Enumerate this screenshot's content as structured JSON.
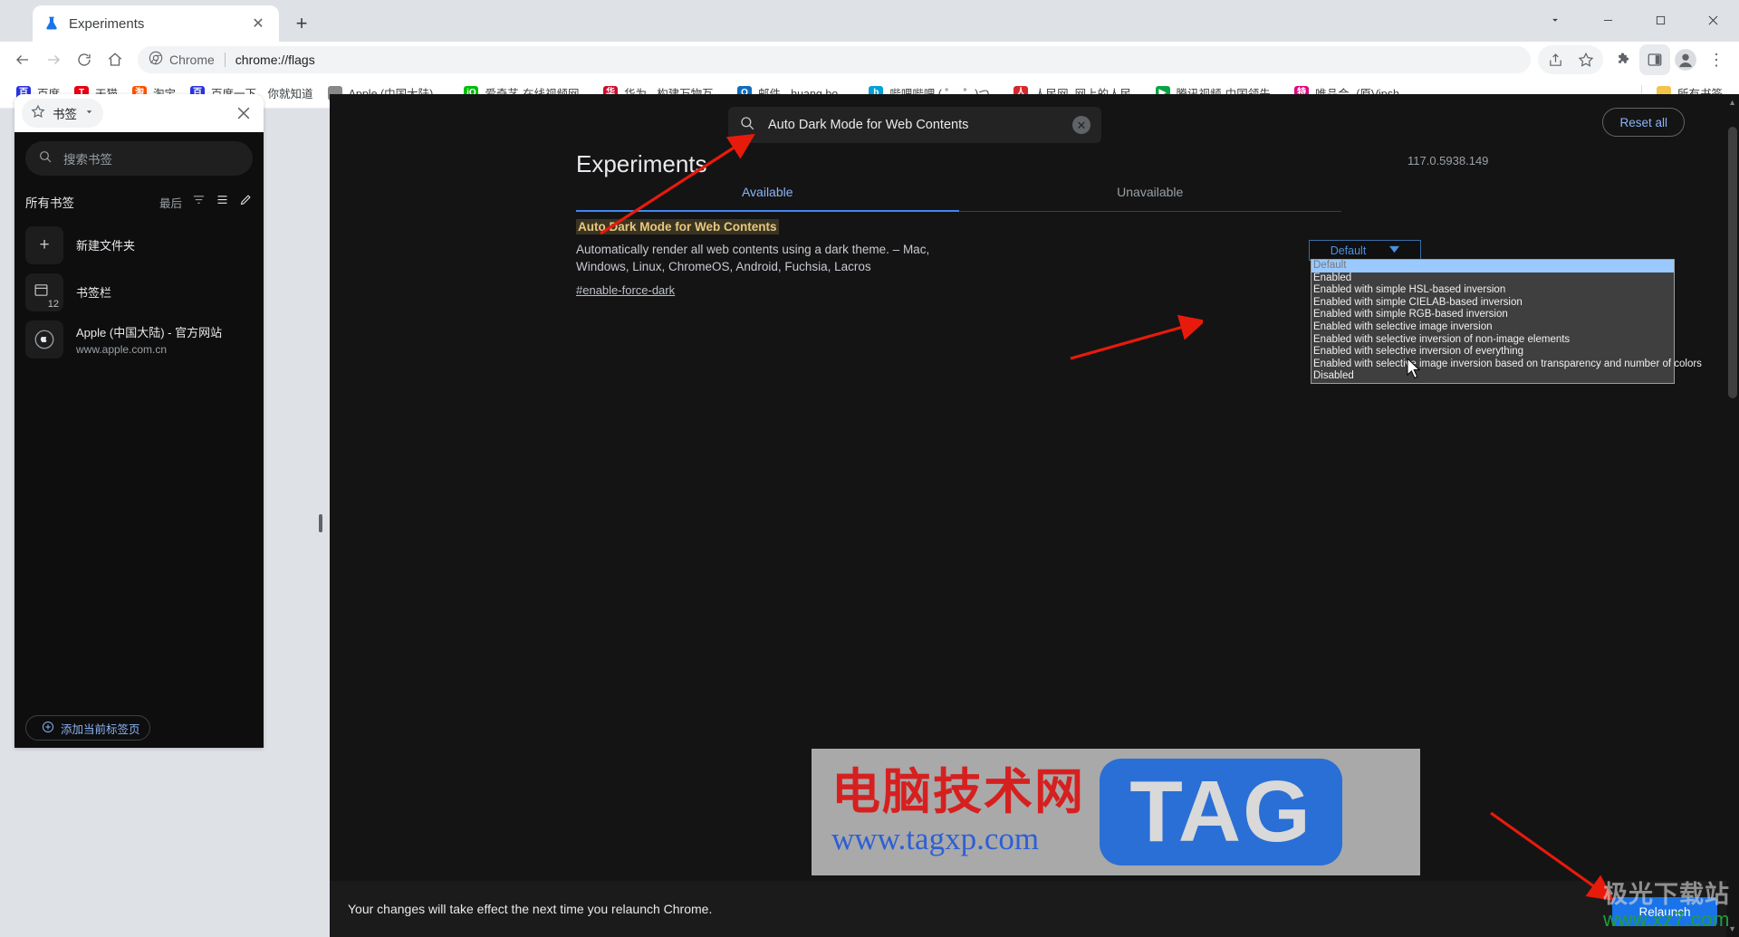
{
  "window": {
    "controls": {
      "minimize": "–",
      "maximize": "□",
      "close": "✕",
      "tabsearch": "⌄"
    }
  },
  "tabstrip": {
    "tab_title": "Experiments",
    "tab_close_label": "✕",
    "new_tab_label": "+"
  },
  "toolbar": {
    "back": "←",
    "forward": "→",
    "reload": "⟳",
    "home": "⌂",
    "chip_label": "Chrome",
    "url": "chrome://flags",
    "share": "share-icon",
    "star": "☆",
    "extensions": "puzzle-icon",
    "sidepanel": "side-panel-icon",
    "profile": "avatar-icon",
    "menu": "⋮"
  },
  "bookmarks_bar": {
    "items": [
      {
        "label": "百度",
        "icon_text": "百",
        "color": "#2932e1"
      },
      {
        "label": "天猫",
        "icon_text": "T",
        "color": "#e60012"
      },
      {
        "label": "淘宝",
        "icon_text": "淘",
        "color": "#ff5000"
      },
      {
        "label": "百度一下，你就知道",
        "icon_text": "百",
        "color": "#2932e1"
      },
      {
        "label": "Apple (中国大陆) -...",
        "icon_text": "",
        "color": "#888888"
      },
      {
        "label": "爱奇艺-在线视频网...",
        "icon_text": "iQ",
        "color": "#00be06"
      },
      {
        "label": "华为 - 构建万物互...",
        "icon_text": "华",
        "color": "#cf0a2c"
      },
      {
        "label": "邮件 - huang bo -...",
        "icon_text": "O",
        "color": "#0f6cbd"
      },
      {
        "label": "哔哩哔哩 ( ゜- ゜)つ...",
        "icon_text": "b",
        "color": "#00a1d6"
      },
      {
        "label": "人民网_网上的人民...",
        "icon_text": "人",
        "color": "#d8272c"
      },
      {
        "label": "腾讯视频-中国领先...",
        "icon_text": "▶",
        "color": "#0aa344"
      },
      {
        "label": "唯品会- (原Vipsh...",
        "icon_text": "特",
        "color": "#e4007f"
      }
    ],
    "all_bookmarks_label": "所有书签",
    "all_bookmarks_icon": "folder-icon"
  },
  "side_panel": {
    "header": {
      "combo_label": "书签",
      "star_icon": "☆",
      "chevron": "▾",
      "close": "✕"
    },
    "search_placeholder": "搜索书签",
    "list_header": {
      "title": "所有书签",
      "sort_label": "最后",
      "filter_icon": "filter-icon",
      "list_icon": "list-icon",
      "edit_icon": "pencil-icon"
    },
    "rows": [
      {
        "title": "新建文件夹",
        "subtitle": "",
        "icon": "plus-icon",
        "count": ""
      },
      {
        "title": "书签栏",
        "subtitle": "",
        "icon": "folder-icon",
        "count": "12"
      },
      {
        "title": "Apple (中国大陆) - 官方网站",
        "subtitle": "www.apple.com.cn",
        "icon": "apple-icon",
        "count": ""
      }
    ],
    "footer": {
      "add_label": "添加当前标签页",
      "add_icon": "plus-circle-icon"
    }
  },
  "flags_page": {
    "search": {
      "value": "Auto Dark Mode for Web Contents",
      "icon": "search-icon",
      "clear_icon": "✕"
    },
    "reset_all_label": "Reset all",
    "title": "Experiments",
    "version": "117.0.5938.149",
    "tabs": [
      {
        "label": "Available",
        "selected": true
      },
      {
        "label": "Unavailable",
        "selected": false
      }
    ],
    "flag": {
      "name": "Auto Dark Mode for Web Contents",
      "description": "Automatically render all web contents using a dark theme. – Mac, Windows, Linux, ChromeOS, Android, Fuchsia, Lacros",
      "link": "#enable-force-dark",
      "select_value": "Default",
      "select_chevron": "⌄",
      "options": [
        "Default",
        "Enabled",
        "Enabled with simple HSL-based inversion",
        "Enabled with simple CIELAB-based inversion",
        "Enabled with simple RGB-based inversion",
        "Enabled with selective image inversion",
        "Enabled with selective inversion of non-image elements",
        "Enabled with selective inversion of everything",
        "Enabled with selective image inversion based on transparency and number of colors",
        "Disabled"
      ],
      "selected_option_index": 0
    },
    "relaunch_notice": "Your changes will take effect the next time you relaunch Chrome.",
    "relaunch_button": "Relaunch"
  },
  "watermarks": {
    "tag": {
      "cn": "电脑技术网",
      "url": "www.tagxp.com",
      "badge": "TAG"
    },
    "xz": {
      "cn": "极光下载站",
      "url": "www.xz7.com"
    }
  },
  "colors": {
    "accent_blue": "#1a73e8",
    "link_blue": "#8ab4f8",
    "page_bg": "#141414",
    "arrow_red": "#e81a0c",
    "highlight_bg": "#3a3522"
  }
}
